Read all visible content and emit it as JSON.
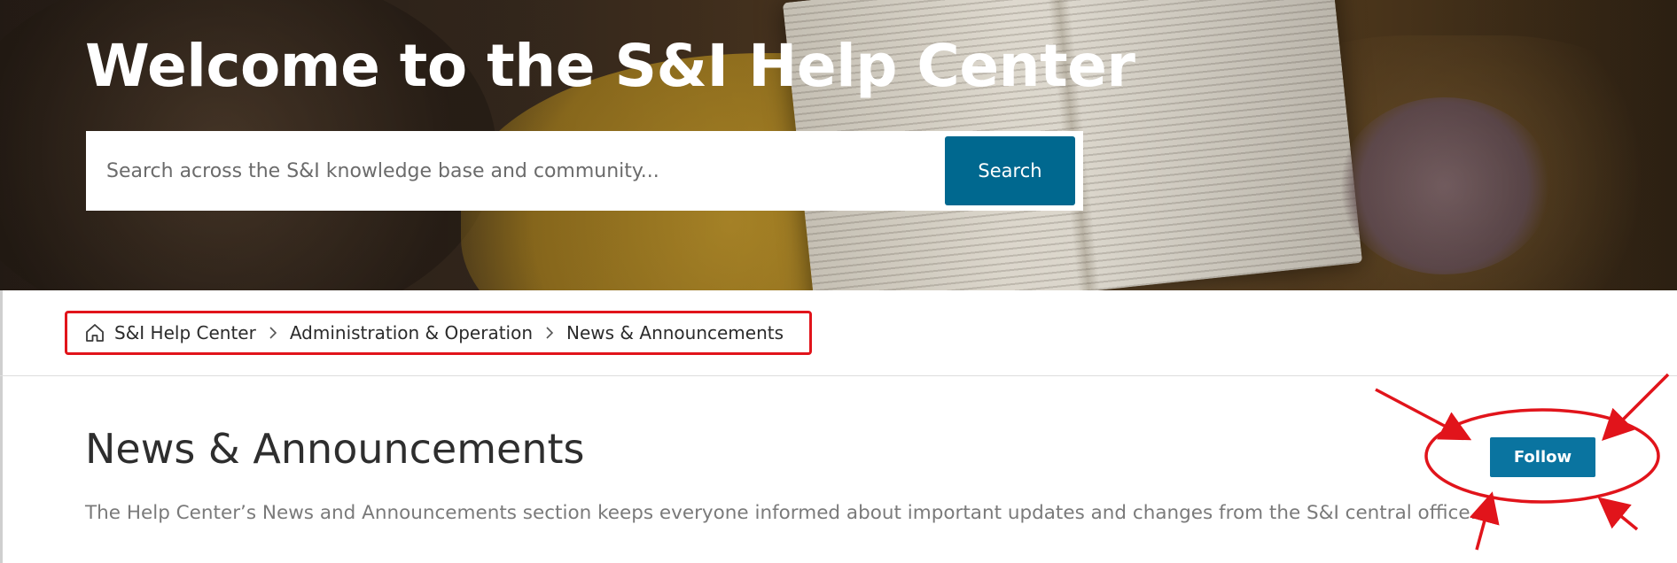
{
  "hero": {
    "title": "Welcome to the S&I Help Center",
    "search": {
      "placeholder": "Search across the S&I knowledge base and community...",
      "button_label": "Search"
    }
  },
  "breadcrumb": {
    "items": [
      {
        "label": "S&I Help Center",
        "icon": "home-icon"
      },
      {
        "label": "Administration & Operation"
      },
      {
        "label": "News & Announcements"
      }
    ]
  },
  "section": {
    "title": "News & Announcements",
    "description": "The Help Center’s News and Announcements section keeps everyone informed about important updates and changes from the S&I central office.",
    "follow_label": "Follow"
  },
  "colors": {
    "accent": "#00688f",
    "follow_button": "#0a74a0",
    "annotation_red": "#e1141b"
  }
}
